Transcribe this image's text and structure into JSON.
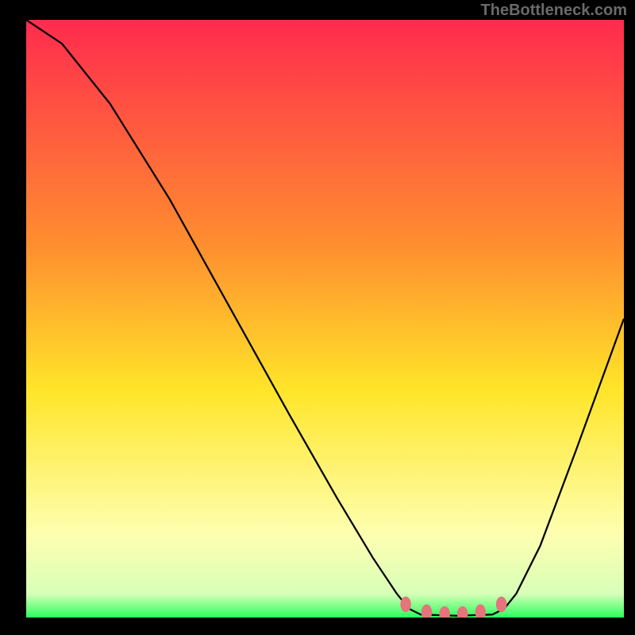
{
  "watermark": "TheBottleneck.com",
  "chart_data": {
    "type": "line",
    "title": "",
    "xlabel": "",
    "ylabel": "",
    "xlim": [
      0,
      100
    ],
    "ylim": [
      0,
      100
    ],
    "gradient_stops": [
      {
        "offset": 0,
        "color": "#ff2b4e"
      },
      {
        "offset": 38,
        "color": "#ff8f2f"
      },
      {
        "offset": 62,
        "color": "#ffe529"
      },
      {
        "offset": 86,
        "color": "#feffb0"
      },
      {
        "offset": 96,
        "color": "#d8ffb8"
      },
      {
        "offset": 100,
        "color": "#2cff5d"
      }
    ],
    "series": [
      {
        "name": "curve",
        "color": "#000000",
        "points": [
          {
            "x": 0,
            "y": 100
          },
          {
            "x": 6,
            "y": 96
          },
          {
            "x": 14,
            "y": 86
          },
          {
            "x": 24,
            "y": 70
          },
          {
            "x": 34,
            "y": 52
          },
          {
            "x": 44,
            "y": 34
          },
          {
            "x": 52,
            "y": 20
          },
          {
            "x": 58,
            "y": 10
          },
          {
            "x": 62,
            "y": 4
          },
          {
            "x": 64,
            "y": 1.5
          },
          {
            "x": 66,
            "y": 0.5
          },
          {
            "x": 72,
            "y": 0.3
          },
          {
            "x": 78,
            "y": 0.5
          },
          {
            "x": 80,
            "y": 1.5
          },
          {
            "x": 82,
            "y": 4
          },
          {
            "x": 86,
            "y": 12
          },
          {
            "x": 92,
            "y": 28
          },
          {
            "x": 100,
            "y": 50
          }
        ]
      }
    ],
    "highlight": {
      "color": "#e6747c",
      "points": [
        {
          "x": 63.5,
          "y": 2.2
        },
        {
          "x": 67,
          "y": 0.9
        },
        {
          "x": 70,
          "y": 0.6
        },
        {
          "x": 73,
          "y": 0.6
        },
        {
          "x": 76,
          "y": 0.9
        },
        {
          "x": 79.5,
          "y": 2.2
        }
      ]
    }
  }
}
